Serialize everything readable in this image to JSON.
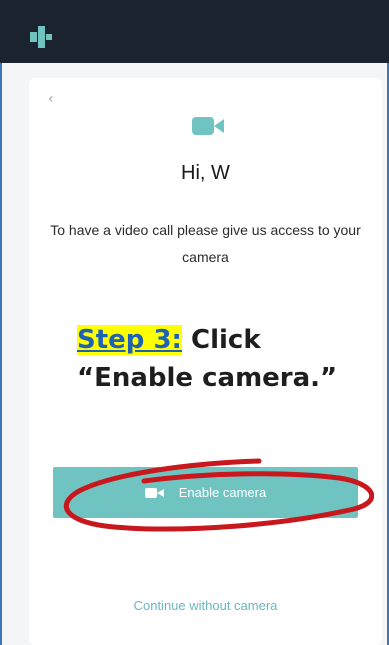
{
  "app": {
    "header_icon": "brand-logo-icon"
  },
  "card": {
    "back_icon": "chevron-left-icon",
    "back_glyph": "‹",
    "camera_icon": "video-camera-icon",
    "title": "Hi, W",
    "description": "To have a video call please give us access to your camera",
    "enable_button": {
      "icon": "video-camera-icon",
      "label": "Enable camera"
    },
    "continue_link": "Continue without camera"
  },
  "instruction": {
    "step_label": "Step 3:",
    "step_text": " Click “Enable camera.”"
  },
  "colors": {
    "topbar": "#1b2331",
    "accent": "#6fc4c1",
    "link": "#6ab7c3",
    "annotation_circle": "#c8181e",
    "highlight": "#ffff00",
    "step_label": "#1e62b5"
  }
}
